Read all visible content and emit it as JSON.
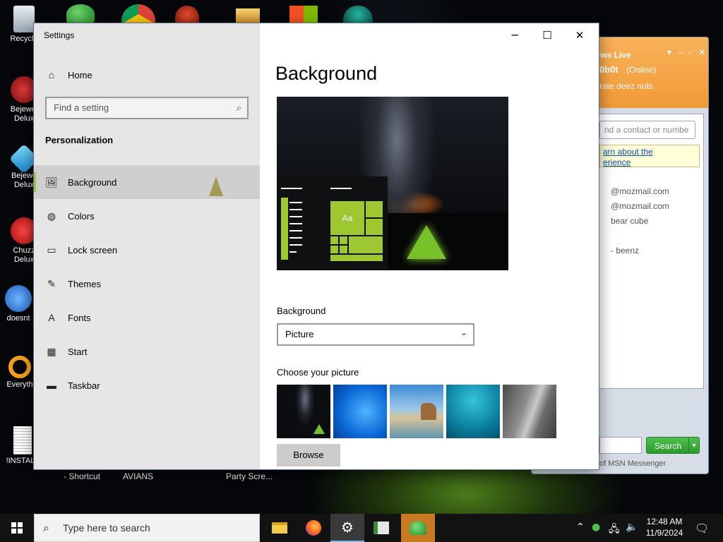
{
  "desktop": {
    "icons": [
      {
        "label": "Recycle"
      },
      {
        "label": "Bejewel Delux"
      },
      {
        "label": "Bejewe Delux"
      },
      {
        "label": "Chuzz Delux"
      },
      {
        "label": "doesnt"
      },
      {
        "label": "Everyth"
      },
      {
        "label": "!INSTALL"
      }
    ],
    "bottom_labels": [
      "- Shortcut",
      "AVIANS",
      "Party Scre..."
    ]
  },
  "msn": {
    "title": "ows Live",
    "user": "0b0t",
    "status": "(Online)",
    "message": "rate deez nuts",
    "search_placeholder": "nd a contact or numbe",
    "learn_line1": "arn about the",
    "learn_line2": "erience",
    "contacts": [
      "@mozmail.com",
      "@mozmail.com",
      "bear cube",
      "- beenz"
    ],
    "search_button": "Search",
    "footer": "of MSN Messenger"
  },
  "settings": {
    "window_title": "Settings",
    "home_label": "Home",
    "find_placeholder": "Find a setting",
    "section_title": "Personalization",
    "nav": [
      {
        "label": "Background",
        "icon": "picture-icon",
        "active": true
      },
      {
        "label": "Colors",
        "icon": "palette-icon",
        "active": false
      },
      {
        "label": "Lock screen",
        "icon": "lock-screen-icon",
        "active": false
      },
      {
        "label": "Themes",
        "icon": "themes-icon",
        "active": false
      },
      {
        "label": "Fonts",
        "icon": "fonts-icon",
        "active": false
      },
      {
        "label": "Start",
        "icon": "start-icon",
        "active": false
      },
      {
        "label": "Taskbar",
        "icon": "taskbar-icon",
        "active": false
      }
    ],
    "page_title": "Background",
    "preview_tile_text": "Aa",
    "background_label": "Background",
    "background_value": "Picture",
    "choose_label": "Choose your picture",
    "browse_label": "Browse",
    "accent_color": "#9ec832"
  },
  "taskbar": {
    "search_placeholder": "Type here to search",
    "time": "12:48 AM",
    "date": "11/9/2024"
  }
}
